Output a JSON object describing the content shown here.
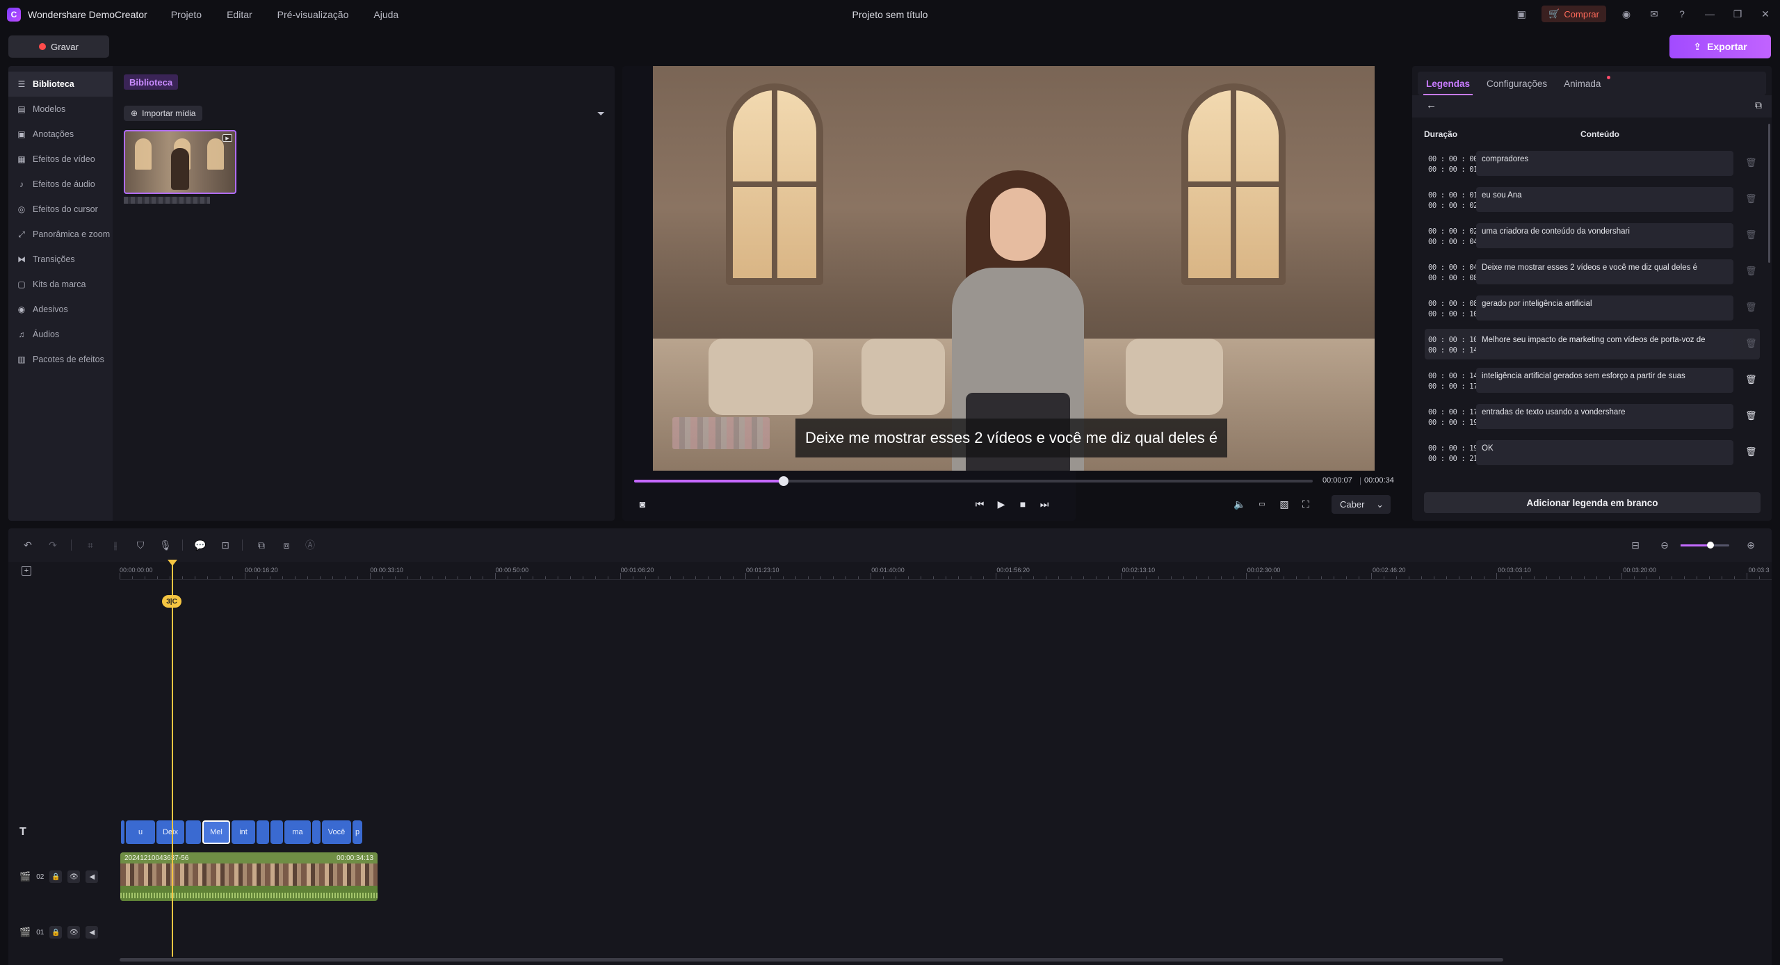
{
  "app": {
    "name": "Wondershare DemoCreator",
    "window_title": "Projeto sem título",
    "menu": [
      "Projeto",
      "Editar",
      "Pré-visualização",
      "Ajuda"
    ],
    "buy_label": "Comprar"
  },
  "toolbar": {
    "record_label": "Gravar",
    "export_label": "Exportar"
  },
  "sidebar": {
    "items": [
      {
        "label": "Biblioteca",
        "icon": "layers-icon",
        "glyph": "☰"
      },
      {
        "label": "Modelos",
        "icon": "templates-icon",
        "glyph": "▤"
      },
      {
        "label": "Anotações",
        "icon": "annotation-icon",
        "glyph": "▣"
      },
      {
        "label": "Efeitos de vídeo",
        "icon": "video-effects-icon",
        "glyph": "▦"
      },
      {
        "label": "Efeitos de áudio",
        "icon": "audio-effects-icon",
        "glyph": "♪"
      },
      {
        "label": "Efeitos do cursor",
        "icon": "cursor-icon",
        "glyph": "◎"
      },
      {
        "label": "Panorâmica e zoom",
        "icon": "pan-zoom-icon",
        "glyph": "⤢"
      },
      {
        "label": "Transições",
        "icon": "transitions-icon",
        "glyph": "⧓"
      },
      {
        "label": "Kits da marca",
        "icon": "brand-kit-icon",
        "glyph": "▢"
      },
      {
        "label": "Adesivos",
        "icon": "sticker-icon",
        "glyph": "◉"
      },
      {
        "label": "Áudios",
        "icon": "music-icon",
        "glyph": "♫"
      },
      {
        "label": "Pacotes de efeitos",
        "icon": "effects-pack-icon",
        "glyph": "▥"
      }
    ]
  },
  "library": {
    "tab_label": "Biblioteca",
    "import_label": "Importar mídia"
  },
  "preview": {
    "subtitle": "Deixe me mostrar esses 2 vídeos e você me diz qual deles é",
    "time_current": "00:00:07",
    "time_total": "00:00:34",
    "progress": 0.22,
    "fit_label": "Caber"
  },
  "captions": {
    "tabs": [
      "Legendas",
      "Configurações",
      "Animada"
    ],
    "head_duration": "Duração",
    "head_content": "Conteúdo",
    "rows": [
      {
        "start": "00 : 00 : 00",
        "end": "00 : 00 : 01",
        "text": "compradores"
      },
      {
        "start": "00 : 00 : 01",
        "end": "00 : 00 : 02",
        "text": "eu sou Ana"
      },
      {
        "start": "00 : 00 : 02",
        "end": "00 : 00 : 04",
        "text": "uma criadora de conteúdo da vondershari"
      },
      {
        "start": "00 : 00 : 04",
        "end": "00 : 00 : 08",
        "text": "Deixe me mostrar esses 2 vídeos e você me diz qual deles é"
      },
      {
        "start": "00 : 00 : 08",
        "end": "00 : 00 : 10",
        "text": "gerado por inteligência artificial"
      },
      {
        "start": "00 : 00 : 10",
        "end": "00 : 00 : 14",
        "text": "Melhore seu impacto de marketing com vídeos de porta-voz de"
      },
      {
        "start": "00 : 00 : 14",
        "end": "00 : 00 : 17",
        "text": "inteligência artificial gerados sem esforço a partir de suas"
      },
      {
        "start": "00 : 00 : 17",
        "end": "00 : 00 : 19",
        "text": "entradas de texto usando a vondershare"
      },
      {
        "start": "00 : 00 : 19",
        "end": "00 : 00 : 21",
        "text": "OK"
      }
    ],
    "add_blank_label": "Adicionar legenda em branco"
  },
  "timeline": {
    "ruler": [
      "00:00:00:00",
      "00:00:16:20",
      "00:00:33:10",
      "00:00:50:00",
      "00:01:06:20",
      "00:01:23:10",
      "00:01:40:00",
      "00:01:56:20",
      "00:02:13:10",
      "00:02:30:00",
      "00:02:46:20",
      "00:03:03:10",
      "00:03:20:00",
      "00:03:3"
    ],
    "playhead_badge": "3|C",
    "tracks": {
      "track02_label": "02",
      "track01_label": "01"
    },
    "text_clips": [
      "",
      "u",
      "Deix",
      "",
      "Mel",
      "int",
      "",
      "",
      "ma",
      "",
      "Você",
      "p"
    ],
    "video_clip": {
      "name": "20241210043637-56",
      "duration": "00:00:34:13"
    }
  }
}
